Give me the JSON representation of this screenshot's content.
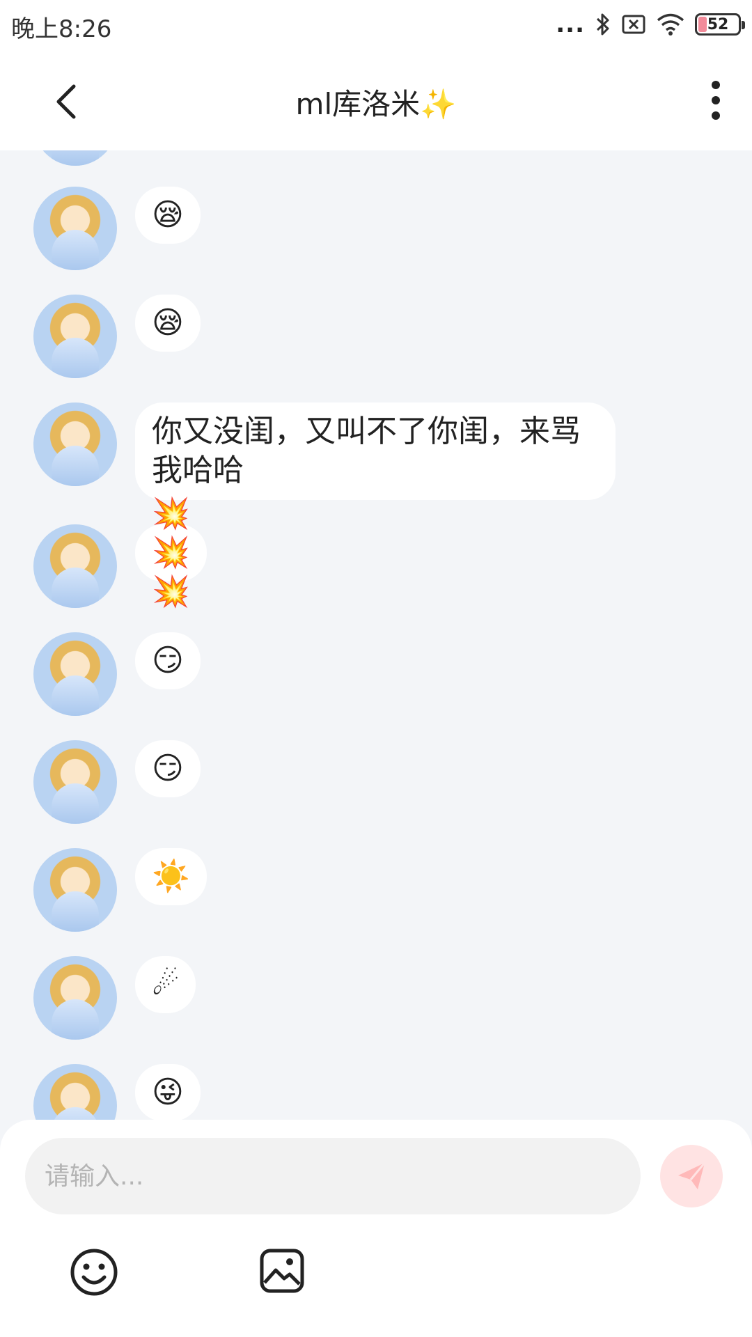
{
  "status_bar": {
    "time": "晚上8:26",
    "dots": "...",
    "battery": "52"
  },
  "header": {
    "title": "ml库洛米✨"
  },
  "messages": [
    {
      "sender": "other",
      "type": "emoji",
      "content": "😪"
    },
    {
      "sender": "other",
      "type": "emoji",
      "content": "😪"
    },
    {
      "sender": "other",
      "type": "text",
      "content": "你又没闺，又叫不了你闺，来骂我哈哈"
    },
    {
      "sender": "other",
      "type": "emoji",
      "content": "💥💥💥"
    },
    {
      "sender": "other",
      "type": "emoji",
      "content": "😏"
    },
    {
      "sender": "other",
      "type": "emoji",
      "content": "😏"
    },
    {
      "sender": "other",
      "type": "emoji",
      "content": "☀️"
    },
    {
      "sender": "other",
      "type": "emoji",
      "content": "☄"
    },
    {
      "sender": "other",
      "type": "emoji",
      "content": "😜"
    }
  ],
  "composer": {
    "placeholder": "请输入..."
  },
  "icons": {
    "back": "back-arrow-icon",
    "more": "more-vertical-icon",
    "send": "paper-plane-icon",
    "emoji": "smiley-icon",
    "image": "image-icon",
    "bluetooth": "bluetooth-icon",
    "sim": "sim-off-icon",
    "wifi": "wifi-icon",
    "battery": "battery-icon"
  },
  "colors": {
    "background": "#f3f5f8",
    "send_button": "#ffe3e3",
    "send_icon": "#ffb3b3"
  }
}
